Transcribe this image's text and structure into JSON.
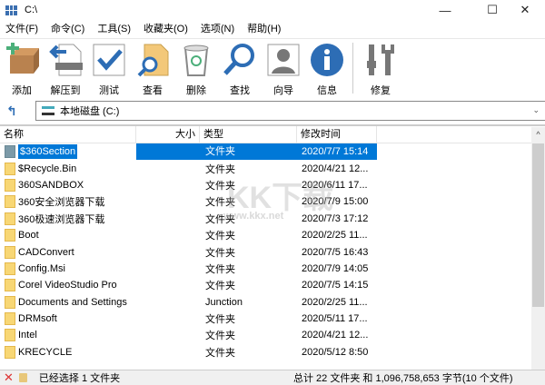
{
  "window": {
    "title": "C:\\",
    "minimize": "—",
    "maximize": "☐",
    "close": "✕"
  },
  "menu": [
    "文件(F)",
    "命令(C)",
    "工具(S)",
    "收藏夹(O)",
    "选项(N)",
    "帮助(H)"
  ],
  "toolbar": [
    {
      "label": "添加",
      "icon": "add-icon"
    },
    {
      "label": "解压到",
      "icon": "extract-icon"
    },
    {
      "label": "测试",
      "icon": "test-icon"
    },
    {
      "label": "查看",
      "icon": "view-icon"
    },
    {
      "label": "删除",
      "icon": "delete-icon"
    },
    {
      "label": "查找",
      "icon": "find-icon"
    },
    {
      "label": "向导",
      "icon": "wizard-icon"
    },
    {
      "label": "信息",
      "icon": "info-icon"
    },
    {
      "label": "修复",
      "icon": "repair-icon"
    }
  ],
  "address": {
    "up": "↰",
    "path": "本地磁盘 (C:)"
  },
  "columns": {
    "name": "名称",
    "size": "大小",
    "type": "类型",
    "modified": "修改时间"
  },
  "files": [
    {
      "name": "$360Section",
      "type": "文件夹",
      "modified": "2020/7/7 15:14",
      "selected": true
    },
    {
      "name": "$Recycle.Bin",
      "type": "文件夹",
      "modified": "2020/4/21 12..."
    },
    {
      "name": "360SANDBOX",
      "type": "文件夹",
      "modified": "2020/6/11 17..."
    },
    {
      "name": "360安全浏览器下载",
      "type": "文件夹",
      "modified": "2020/7/9 15:00"
    },
    {
      "name": "360极速浏览器下载",
      "type": "文件夹",
      "modified": "2020/7/3 17:12"
    },
    {
      "name": "Boot",
      "type": "文件夹",
      "modified": "2020/2/25 11..."
    },
    {
      "name": "CADConvert",
      "type": "文件夹",
      "modified": "2020/7/5 16:43"
    },
    {
      "name": "Config.Msi",
      "type": "文件夹",
      "modified": "2020/7/9 14:05"
    },
    {
      "name": "Corel VideoStudio Pro",
      "type": "文件夹",
      "modified": "2020/7/5 14:15"
    },
    {
      "name": "Documents and Settings",
      "type": "Junction",
      "modified": "2020/2/25 11..."
    },
    {
      "name": "DRMsoft",
      "type": "文件夹",
      "modified": "2020/5/11 17..."
    },
    {
      "name": "Intel",
      "type": "文件夹",
      "modified": "2020/4/21 12..."
    },
    {
      "name": "KRECYCLE",
      "type": "文件夹",
      "modified": "2020/5/12 8:50"
    }
  ],
  "status": {
    "left": "已经选择 1 文件夹",
    "right": "总计 22 文件夹 和 1,096,758,653 字节(10 个文件)"
  },
  "watermark": {
    "logo": "KK下载",
    "url": "www.kkx.net"
  }
}
